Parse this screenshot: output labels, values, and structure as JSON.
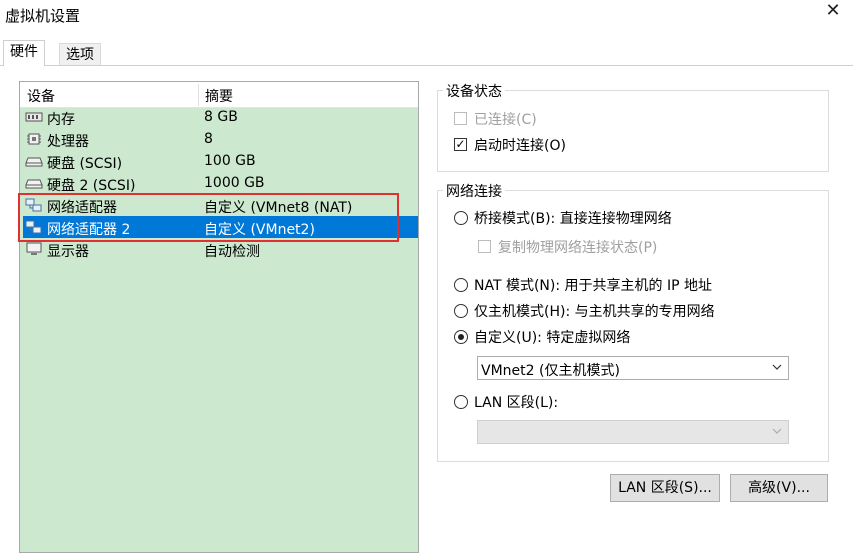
{
  "window": {
    "title": "虚拟机设置"
  },
  "tabs": [
    {
      "label": "硬件"
    },
    {
      "label": "选项"
    }
  ],
  "device_list": {
    "columns": [
      "设备",
      "摘要"
    ],
    "rows": [
      {
        "name": "内存",
        "summary": "8 GB",
        "icon": "memory-icon"
      },
      {
        "name": "处理器",
        "summary": "8",
        "icon": "cpu-icon"
      },
      {
        "name": "硬盘 (SCSI)",
        "summary": "100 GB",
        "icon": "hard-disk-icon"
      },
      {
        "name": "硬盘 2 (SCSI)",
        "summary": "1000 GB",
        "icon": "hard-disk-icon"
      },
      {
        "name": "网络适配器",
        "summary": "自定义 (VMnet8 (NAT)",
        "icon": "network-adapter-icon"
      },
      {
        "name": "网络适配器 2",
        "summary": "自定义 (VMnet2)",
        "icon": "network-adapter-icon",
        "selected": true
      },
      {
        "name": "显示器",
        "summary": "自动检测",
        "icon": "monitor-icon"
      }
    ]
  },
  "device_status": {
    "title": "设备状态",
    "connected": {
      "label": "已连接(C)",
      "checked": false,
      "disabled": true
    },
    "connect_at_power_on": {
      "label": "启动时连接(O)",
      "checked": true
    }
  },
  "network_connection": {
    "title": "网络连接",
    "bridged": {
      "label": "桥接模式(B): 直接连接物理网络",
      "selected": false
    },
    "replicate_state": {
      "label": "复制物理网络连接状态(P)",
      "checked": false,
      "disabled": true
    },
    "nat": {
      "label": "NAT 模式(N): 用于共享主机的 IP 地址",
      "selected": false
    },
    "host_only": {
      "label": "仅主机模式(H): 与主机共享的专用网络",
      "selected": false
    },
    "custom": {
      "label": "自定义(U): 特定虚拟网络",
      "selected": true
    },
    "custom_value": "VMnet2 (仅主机模式)",
    "lan_segment": {
      "label": "LAN 区段(L):",
      "selected": false
    },
    "lan_value": ""
  },
  "buttons": {
    "lan_segments": "LAN 区段(S)...",
    "advanced": "高级(V)..."
  },
  "colors": {
    "list_bg": "#cce8cf",
    "selection": "#0078d7",
    "highlight_box": "#e03030"
  }
}
